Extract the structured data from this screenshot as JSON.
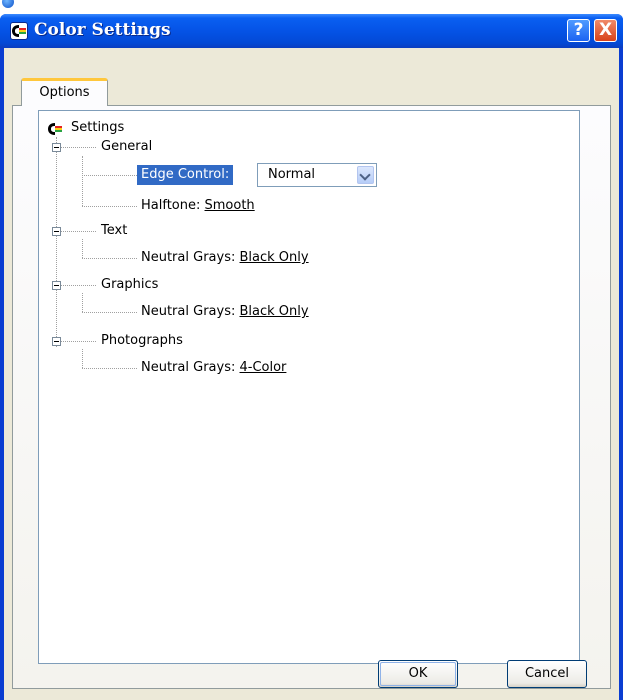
{
  "window": {
    "title": "Color Settings",
    "help_glyph": "?",
    "close_glyph": "X"
  },
  "tabs": [
    {
      "label": "Options"
    }
  ],
  "tree": {
    "root": {
      "label": "Settings"
    },
    "groups": [
      {
        "label": "General",
        "items": [
          {
            "label": "Edge Control:",
            "control": "dropdown",
            "value": "Normal"
          },
          {
            "label": "Halftone:",
            "value": "Smooth"
          }
        ]
      },
      {
        "label": "Text",
        "items": [
          {
            "label": "Neutral Grays:",
            "value": "Black Only"
          }
        ]
      },
      {
        "label": "Graphics",
        "items": [
          {
            "label": "Neutral Grays:",
            "value": "Black Only"
          }
        ]
      },
      {
        "label": "Photographs",
        "items": [
          {
            "label": "Neutral Grays:",
            "value": "4-Color"
          }
        ]
      }
    ]
  },
  "buttons": {
    "ok": "OK",
    "cancel": "Cancel"
  },
  "colors": {
    "titlebar": "#0553e6",
    "selection": "#316ac5",
    "dialog_bg": "#ece9d8"
  }
}
